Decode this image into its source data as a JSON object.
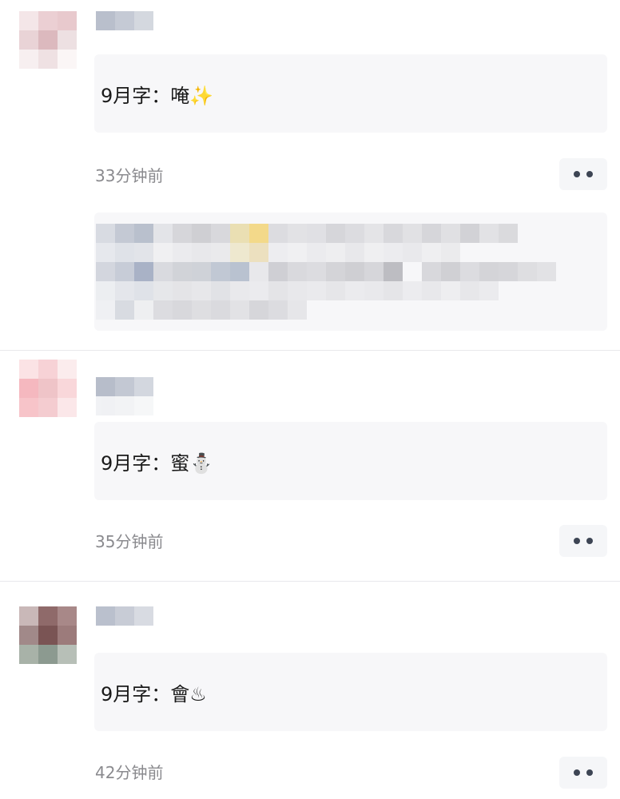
{
  "comments": [
    {
      "text": "9月字：唵",
      "emoji": "✨",
      "time": "33分钟前"
    },
    {
      "text": "9月字：蜜",
      "emoji": "⛄",
      "time": "35分钟前"
    },
    {
      "text": "9月字：會",
      "emoji": "♨",
      "time": "42分钟前"
    }
  ],
  "icons": {
    "more": "more-dots-icon"
  }
}
